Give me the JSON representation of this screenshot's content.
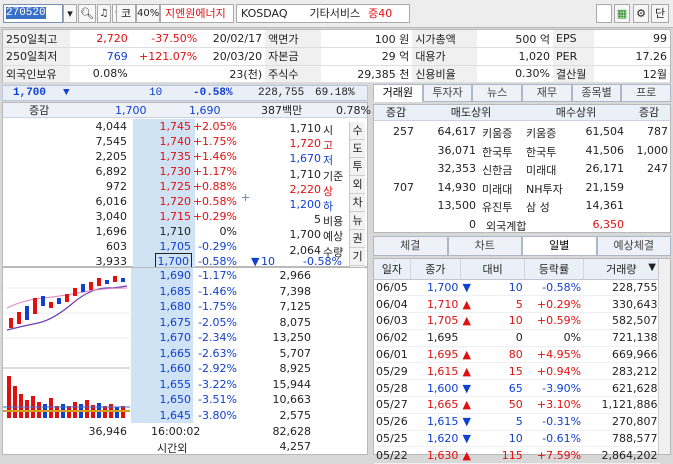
{
  "toolbar": {
    "code": "270520",
    "market": "코",
    "ratio": "40%",
    "name": "지엔원에너지",
    "exchange": "KOSDAQ",
    "sector": "기타서비스",
    "margin": "증40",
    "btn_order": "단"
  },
  "info": [
    [
      "250일최고",
      "2,720",
      "-37.50%",
      "20/02/17",
      "액면가",
      "100 원",
      "시가총액",
      "500 억",
      "EPS",
      "99"
    ],
    [
      "250일최저",
      "769",
      "+121.07%",
      "20/03/20",
      "자본금",
      "29 억",
      "대용가",
      "1,020",
      "PER",
      "17.26"
    ],
    [
      "외국인보유",
      "0.08%",
      "",
      "23(천)",
      "주식수",
      "29,385 천",
      "신용비율",
      "0.30%",
      "결산월",
      "12월"
    ]
  ],
  "current": {
    "price": "1,700",
    "change": "10",
    "rate": "-0.58%",
    "volume": "228,755",
    "vol_rate": "69.18%"
  },
  "ob_head": {
    "label": "증감",
    "ask_total_label": "1,700",
    "bid_total_label": "1,690",
    "amount": "387백만",
    "pct": "0.78%"
  },
  "asks": [
    {
      "qty": "4,044",
      "price": "1,745",
      "rate": "+2.05%"
    },
    {
      "qty": "7,545",
      "price": "1,740",
      "rate": "+1.75%"
    },
    {
      "qty": "2,205",
      "price": "1,735",
      "rate": "+1.46%"
    },
    {
      "qty": "6,892",
      "price": "1,730",
      "rate": "+1.17%"
    },
    {
      "qty": "972",
      "price": "1,725",
      "rate": "+0.88%"
    },
    {
      "qty": "6,016",
      "price": "1,720",
      "rate": "+0.58%"
    },
    {
      "qty": "3,040",
      "price": "1,715",
      "rate": "+0.29%"
    },
    {
      "qty": "1,696",
      "price": "1,710",
      "rate": "0%"
    },
    {
      "qty": "603",
      "price": "1,705",
      "rate": "-0.29%"
    },
    {
      "qty": "3,933",
      "price": "1,700",
      "rate": "-0.58%"
    }
  ],
  "summary": [
    {
      "v": "1,710",
      "l": "시"
    },
    {
      "v": "1,720",
      "l": "고"
    },
    {
      "v": "1,670",
      "l": "저"
    },
    {
      "v": "1,710",
      "l": "기준"
    },
    {
      "v": "2,220",
      "l": "상"
    },
    {
      "v": "1,200",
      "l": "하"
    },
    {
      "v": "5",
      "l": "비용"
    },
    {
      "v": "1,700",
      "l": "예상"
    },
    {
      "v": "2,064",
      "l": "수량"
    }
  ],
  "expected": {
    "price": "10",
    "rate": "-0.58%"
  },
  "side_tabs": [
    "수",
    "도",
    "투",
    "외",
    "차",
    "뉴",
    "권",
    "기"
  ],
  "bids": [
    {
      "price": "1,690",
      "rate": "-1.17%",
      "qty": "2,966"
    },
    {
      "price": "1,685",
      "rate": "-1.46%",
      "qty": "7,398"
    },
    {
      "price": "1,680",
      "rate": "-1.75%",
      "qty": "7,125"
    },
    {
      "price": "1,675",
      "rate": "-2.05%",
      "qty": "8,075"
    },
    {
      "price": "1,670",
      "rate": "-2.34%",
      "qty": "13,250"
    },
    {
      "price": "1,665",
      "rate": "-2.63%",
      "qty": "5,707"
    },
    {
      "price": "1,660",
      "rate": "-2.92%",
      "qty": "8,925"
    },
    {
      "price": "1,655",
      "rate": "-3.22%",
      "qty": "15,944"
    },
    {
      "price": "1,650",
      "rate": "-3.51%",
      "qty": "10,663"
    },
    {
      "price": "1,645",
      "rate": "-3.80%",
      "qty": "2,575"
    }
  ],
  "ob_foot": {
    "ask_total": "36,946",
    "time": "16:00:02",
    "time_label": "시간외",
    "bid_total": "82,628",
    "after": "4,257"
  },
  "broker_tabs": [
    "거래원",
    "투자자",
    "뉴스",
    "재무",
    "종목별",
    "프로"
  ],
  "broker_head": [
    "증감",
    "매도상위",
    "매수상위",
    "증감"
  ],
  "brokers": [
    {
      "chg1": "257",
      "sq": "64,617",
      "sn": "키움증",
      "bn": "키움증",
      "bq": "61,504",
      "chg2": "787"
    },
    {
      "chg1": "",
      "sq": "36,071",
      "sn": "한국투",
      "bn": "한국투",
      "bq": "41,506",
      "chg2": "1,000"
    },
    {
      "chg1": "",
      "sq": "32,353",
      "sn": "신한금",
      "bn": "미래대",
      "bq": "26,171",
      "chg2": "247"
    },
    {
      "chg1": "707",
      "sq": "14,930",
      "sn": "미래대",
      "bn": "NH투자",
      "bq": "21,159",
      "chg2": ""
    },
    {
      "chg1": "",
      "sq": "13,500",
      "sn": "유진투",
      "bn": "삼  성",
      "bq": "14,361",
      "chg2": ""
    }
  ],
  "broker_foot": {
    "left": "0",
    "label": "외국계합",
    "right": "6,350"
  },
  "daily_tabs": [
    "체결",
    "차트",
    "일별",
    "예상체결"
  ],
  "daily_head": [
    "일자",
    "종가",
    "대비",
    "등락률",
    "거래량"
  ],
  "daily": [
    {
      "d": "06/05",
      "c": "1,700",
      "dir": "dn",
      "ch": "10",
      "r": "-0.58%",
      "v": "228,755"
    },
    {
      "d": "06/04",
      "c": "1,710",
      "dir": "up",
      "ch": "5",
      "r": "+0.29%",
      "v": "330,643"
    },
    {
      "d": "06/03",
      "c": "1,705",
      "dir": "up",
      "ch": "10",
      "r": "+0.59%",
      "v": "582,507"
    },
    {
      "d": "06/02",
      "c": "1,695",
      "dir": "",
      "ch": "0",
      "r": "0%",
      "v": "721,138"
    },
    {
      "d": "06/01",
      "c": "1,695",
      "dir": "up",
      "ch": "80",
      "r": "+4.95%",
      "v": "669,966"
    },
    {
      "d": "05/29",
      "c": "1,615",
      "dir": "up",
      "ch": "15",
      "r": "+0.94%",
      "v": "283,212"
    },
    {
      "d": "05/28",
      "c": "1,600",
      "dir": "dn",
      "ch": "65",
      "r": "-3.90%",
      "v": "621,628"
    },
    {
      "d": "05/27",
      "c": "1,665",
      "dir": "up",
      "ch": "50",
      "r": "+3.10%",
      "v": "1,121,886"
    },
    {
      "d": "05/26",
      "c": "1,615",
      "dir": "dn",
      "ch": "5",
      "r": "-0.31%",
      "v": "270,807"
    },
    {
      "d": "05/25",
      "c": "1,620",
      "dir": "dn",
      "ch": "10",
      "r": "-0.61%",
      "v": "788,577"
    },
    {
      "d": "05/22",
      "c": "1,630",
      "dir": "up",
      "ch": "115",
      "r": "+7.59%",
      "v": "2,864,202"
    }
  ],
  "colors": {
    "up": "#e01010",
    "down": "#1040d0",
    "accent": "#3870c8"
  }
}
